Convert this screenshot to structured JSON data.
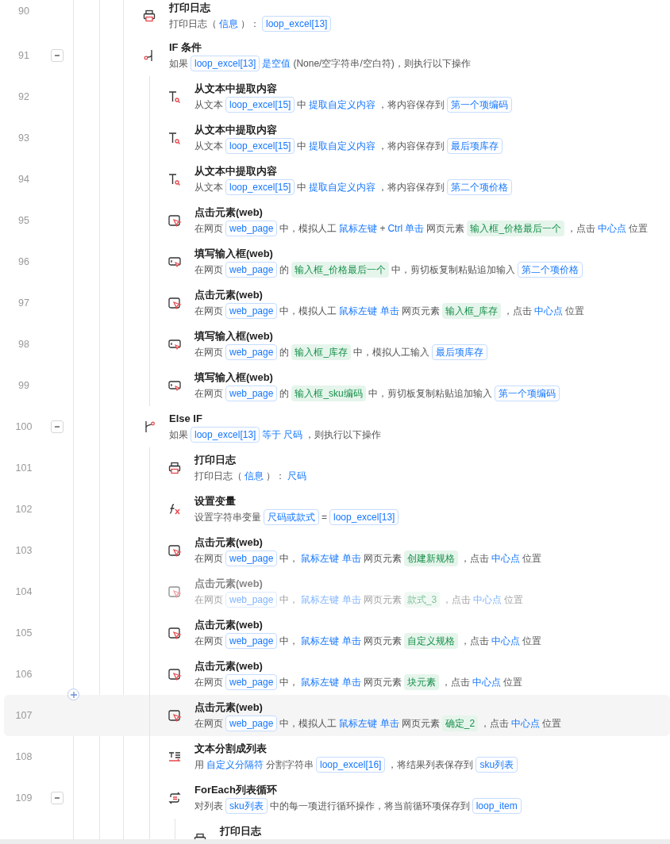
{
  "steps": [
    {
      "line": "90",
      "kind": "print",
      "title": "打印日志",
      "disabled": false,
      "selected": false,
      "desc": [
        {
          "kind": "text",
          "text": "打印日志（"
        },
        {
          "kind": "keyword",
          "text": "信息"
        },
        {
          "kind": "text",
          "text": "）："
        },
        {
          "kind": "var",
          "text": "loop_excel[13]"
        }
      ]
    },
    {
      "line": "91",
      "kind": "if",
      "title": "IF 条件",
      "disabled": false,
      "selected": false,
      "expanded": true,
      "desc": [
        {
          "kind": "text",
          "text": "如果"
        },
        {
          "kind": "var",
          "text": "loop_excel[13]"
        },
        {
          "kind": "keyword",
          "text": "是空值"
        },
        {
          "kind": "text",
          "text": "(None/空字符串/空白符)，则执行以下操作"
        }
      ],
      "children": [
        {
          "line": "92",
          "kind": "extract",
          "title": "从文本中提取内容",
          "disabled": false,
          "selected": false,
          "desc": [
            {
              "kind": "text",
              "text": "从文本"
            },
            {
              "kind": "var",
              "text": "loop_excel[15]"
            },
            {
              "kind": "text",
              "text": "中"
            },
            {
              "kind": "keyword",
              "text": "提取自定义内容"
            },
            {
              "kind": "text",
              "text": "，将内容保存到"
            },
            {
              "kind": "var",
              "text": "第一个项编码"
            }
          ]
        },
        {
          "line": "93",
          "kind": "extract",
          "title": "从文本中提取内容",
          "disabled": false,
          "selected": false,
          "desc": [
            {
              "kind": "text",
              "text": "从文本"
            },
            {
              "kind": "var",
              "text": "loop_excel[15]"
            },
            {
              "kind": "text",
              "text": "中"
            },
            {
              "kind": "keyword",
              "text": "提取自定义内容"
            },
            {
              "kind": "text",
              "text": "，将内容保存到"
            },
            {
              "kind": "var",
              "text": "最后项库存"
            }
          ]
        },
        {
          "line": "94",
          "kind": "extract",
          "title": "从文本中提取内容",
          "disabled": false,
          "selected": false,
          "desc": [
            {
              "kind": "text",
              "text": "从文本"
            },
            {
              "kind": "var",
              "text": "loop_excel[15]"
            },
            {
              "kind": "text",
              "text": "中"
            },
            {
              "kind": "keyword",
              "text": "提取自定义内容"
            },
            {
              "kind": "text",
              "text": "，将内容保存到"
            },
            {
              "kind": "var",
              "text": "第二个项价格"
            }
          ]
        },
        {
          "line": "95",
          "kind": "click",
          "title": "点击元素(web)",
          "disabled": false,
          "selected": false,
          "desc": [
            {
              "kind": "text",
              "text": "在网页"
            },
            {
              "kind": "var",
              "text": "web_page"
            },
            {
              "kind": "text",
              "text": "中，模拟人工"
            },
            {
              "kind": "keyword",
              "text": "鼠标左键"
            },
            {
              "kind": "text",
              "text": "+"
            },
            {
              "kind": "keyword",
              "text": "Ctrl 单击"
            },
            {
              "kind": "text",
              "text": "网页元素"
            },
            {
              "kind": "element",
              "text": "输入框_价格最后一个"
            },
            {
              "kind": "text",
              "text": "，点击"
            },
            {
              "kind": "keyword",
              "text": "中心点"
            },
            {
              "kind": "text",
              "text": "位置"
            }
          ]
        },
        {
          "line": "96",
          "kind": "fill",
          "title": "填写输入框(web)",
          "disabled": false,
          "selected": false,
          "desc": [
            {
              "kind": "text",
              "text": "在网页"
            },
            {
              "kind": "var",
              "text": "web_page"
            },
            {
              "kind": "text",
              "text": "的"
            },
            {
              "kind": "element",
              "text": "输入框_价格最后一个"
            },
            {
              "kind": "text",
              "text": "中，剪切板复制粘贴追加输入"
            },
            {
              "kind": "var",
              "text": "第二个项价格"
            }
          ]
        },
        {
          "line": "97",
          "kind": "click",
          "title": "点击元素(web)",
          "disabled": false,
          "selected": false,
          "desc": [
            {
              "kind": "text",
              "text": "在网页"
            },
            {
              "kind": "var",
              "text": "web_page"
            },
            {
              "kind": "text",
              "text": "中，模拟人工"
            },
            {
              "kind": "keyword",
              "text": "鼠标左键 单击"
            },
            {
              "kind": "text",
              "text": "网页元素"
            },
            {
              "kind": "element",
              "text": "输入框_库存"
            },
            {
              "kind": "text",
              "text": "，点击"
            },
            {
              "kind": "keyword",
              "text": "中心点"
            },
            {
              "kind": "text",
              "text": "位置"
            }
          ]
        },
        {
          "line": "98",
          "kind": "fill",
          "title": "填写输入框(web)",
          "disabled": false,
          "selected": false,
          "desc": [
            {
              "kind": "text",
              "text": "在网页"
            },
            {
              "kind": "var",
              "text": "web_page"
            },
            {
              "kind": "text",
              "text": "的"
            },
            {
              "kind": "element",
              "text": "输入框_库存"
            },
            {
              "kind": "text",
              "text": "中，模拟人工输入"
            },
            {
              "kind": "var",
              "text": "最后项库存"
            }
          ]
        },
        {
          "line": "99",
          "kind": "fill",
          "title": "填写输入框(web)",
          "disabled": false,
          "selected": false,
          "desc": [
            {
              "kind": "text",
              "text": "在网页"
            },
            {
              "kind": "var",
              "text": "web_page"
            },
            {
              "kind": "text",
              "text": "的"
            },
            {
              "kind": "element",
              "text": "输入框_sku编码"
            },
            {
              "kind": "text",
              "text": "中，剪切板复制粘贴追加输入"
            },
            {
              "kind": "var",
              "text": "第一个项编码"
            }
          ]
        }
      ]
    },
    {
      "line": "100",
      "kind": "elseif",
      "title": "Else IF",
      "disabled": false,
      "selected": false,
      "expanded": true,
      "desc": [
        {
          "kind": "text",
          "text": "如果"
        },
        {
          "kind": "var",
          "text": "loop_excel[13]"
        },
        {
          "kind": "keyword",
          "text": "等于"
        },
        {
          "kind": "keyword",
          "text": "尺码"
        },
        {
          "kind": "text",
          "text": "，则执行以下操作"
        }
      ],
      "children": [
        {
          "line": "101",
          "kind": "print",
          "title": "打印日志",
          "disabled": false,
          "selected": false,
          "desc": [
            {
              "kind": "text",
              "text": "打印日志（"
            },
            {
              "kind": "keyword",
              "text": "信息"
            },
            {
              "kind": "text",
              "text": "）："
            },
            {
              "kind": "keyword",
              "text": "尺码"
            }
          ]
        },
        {
          "line": "102",
          "kind": "setvar",
          "title": "设置变量",
          "disabled": false,
          "selected": false,
          "desc": [
            {
              "kind": "text",
              "text": "设置字符串变量"
            },
            {
              "kind": "var",
              "text": "尺码或款式"
            },
            {
              "kind": "text",
              "text": "="
            },
            {
              "kind": "var",
              "text": "loop_excel[13]"
            }
          ]
        },
        {
          "line": "103",
          "kind": "click",
          "title": "点击元素(web)",
          "disabled": false,
          "selected": false,
          "desc": [
            {
              "kind": "text",
              "text": "在网页"
            },
            {
              "kind": "var",
              "text": "web_page"
            },
            {
              "kind": "text",
              "text": "中，"
            },
            {
              "kind": "keyword",
              "text": "鼠标左键 单击"
            },
            {
              "kind": "text",
              "text": "网页元素"
            },
            {
              "kind": "element",
              "text": "创建新规格"
            },
            {
              "kind": "text",
              "text": "，点击"
            },
            {
              "kind": "keyword",
              "text": "中心点"
            },
            {
              "kind": "text",
              "text": "位置"
            }
          ]
        },
        {
          "line": "104",
          "kind": "click",
          "title": "点击元素(web)",
          "disabled": true,
          "selected": false,
          "desc": [
            {
              "kind": "text",
              "text": "在网页"
            },
            {
              "kind": "var",
              "text": "web_page"
            },
            {
              "kind": "text",
              "text": "中，"
            },
            {
              "kind": "keyword",
              "text": "鼠标左键 单击"
            },
            {
              "kind": "text",
              "text": "网页元素"
            },
            {
              "kind": "element",
              "text": "款式_3"
            },
            {
              "kind": "text",
              "text": "，点击"
            },
            {
              "kind": "keyword",
              "text": "中心点"
            },
            {
              "kind": "text",
              "text": "位置"
            }
          ]
        },
        {
          "line": "105",
          "kind": "click",
          "title": "点击元素(web)",
          "disabled": false,
          "selected": false,
          "desc": [
            {
              "kind": "text",
              "text": "在网页"
            },
            {
              "kind": "var",
              "text": "web_page"
            },
            {
              "kind": "text",
              "text": "中，"
            },
            {
              "kind": "keyword",
              "text": "鼠标左键 单击"
            },
            {
              "kind": "text",
              "text": "网页元素"
            },
            {
              "kind": "element",
              "text": "自定义规格"
            },
            {
              "kind": "text",
              "text": "，点击"
            },
            {
              "kind": "keyword",
              "text": "中心点"
            },
            {
              "kind": "text",
              "text": "位置"
            }
          ]
        },
        {
          "line": "106",
          "kind": "click",
          "title": "点击元素(web)",
          "disabled": false,
          "selected": false,
          "desc": [
            {
              "kind": "text",
              "text": "在网页"
            },
            {
              "kind": "var",
              "text": "web_page"
            },
            {
              "kind": "text",
              "text": "中，"
            },
            {
              "kind": "keyword",
              "text": "鼠标左键 单击"
            },
            {
              "kind": "text",
              "text": "网页元素"
            },
            {
              "kind": "element",
              "text": "块元素"
            },
            {
              "kind": "text",
              "text": "，点击"
            },
            {
              "kind": "keyword",
              "text": "中心点"
            },
            {
              "kind": "text",
              "text": "位置"
            }
          ]
        },
        {
          "line": "107",
          "kind": "click",
          "title": "点击元素(web)",
          "disabled": false,
          "selected": true,
          "desc": [
            {
              "kind": "text",
              "text": "在网页"
            },
            {
              "kind": "var",
              "text": "web_page"
            },
            {
              "kind": "text",
              "text": "中，模拟人工"
            },
            {
              "kind": "keyword",
              "text": "鼠标左键 单击"
            },
            {
              "kind": "text",
              "text": "网页元素"
            },
            {
              "kind": "element",
              "text": "确定_2"
            },
            {
              "kind": "text",
              "text": "，点击"
            },
            {
              "kind": "keyword",
              "text": "中心点"
            },
            {
              "kind": "text",
              "text": "位置"
            }
          ]
        },
        {
          "line": "108",
          "kind": "split",
          "title": "文本分割成列表",
          "disabled": false,
          "selected": false,
          "desc": [
            {
              "kind": "text",
              "text": "用"
            },
            {
              "kind": "keyword",
              "text": "自定义分隔符"
            },
            {
              "kind": "text",
              "text": "分割字符串"
            },
            {
              "kind": "var",
              "text": "loop_excel[16]"
            },
            {
              "kind": "text",
              "text": "，将结果列表保存到"
            },
            {
              "kind": "var",
              "text": "sku列表"
            }
          ]
        },
        {
          "line": "109",
          "kind": "foreach",
          "title": "ForEach列表循环",
          "disabled": false,
          "selected": false,
          "expanded": true,
          "desc": [
            {
              "kind": "text",
              "text": "对列表"
            },
            {
              "kind": "var",
              "text": "sku列表"
            },
            {
              "kind": "text",
              "text": "中的每一项进行循环操作，将当前循环项保存到"
            },
            {
              "kind": "var",
              "text": "loop_item"
            }
          ],
          "children": [
            {
              "kind": "print",
              "title": "打印日志",
              "disabled": false,
              "selected": false
            }
          ]
        }
      ]
    }
  ]
}
